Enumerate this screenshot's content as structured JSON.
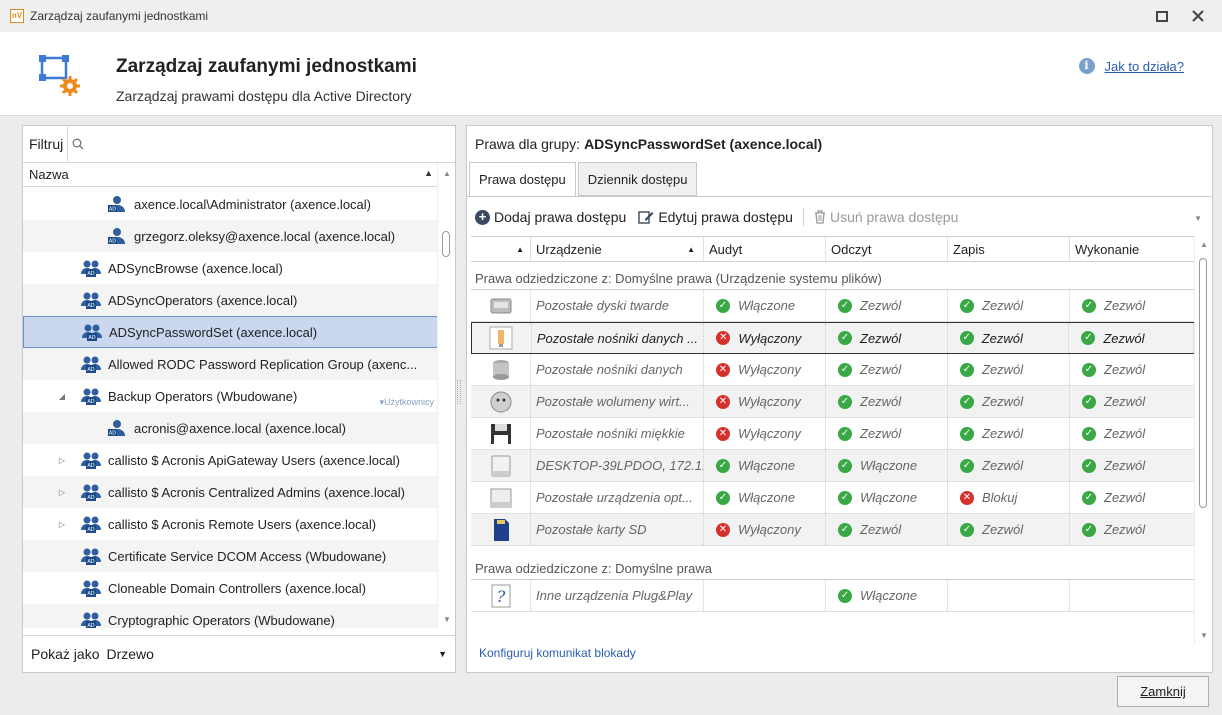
{
  "window": {
    "app_icon_text": "nV",
    "title": "Zarządzaj zaufanymi jednostkami"
  },
  "header": {
    "title": "Zarządzaj zaufanymi jednostkami",
    "subtitle": "Zarządzaj prawami dostępu dla Active Directory",
    "help_link": "Jak to działa?"
  },
  "left": {
    "filter_label": "Filtruj",
    "filter_value": "",
    "column_name": "Nazwa",
    "tree": [
      {
        "label": "axence.local\\Administrator (axence.local)",
        "kind": "user",
        "level": 2,
        "expander": ""
      },
      {
        "label": "grzegorz.oleksy@axence.local (axence.local)",
        "kind": "user",
        "level": 2,
        "expander": ""
      },
      {
        "label": "ADSyncBrowse (axence.local)",
        "kind": "group",
        "level": 1,
        "expander": ""
      },
      {
        "label": "ADSyncOperators (axence.local)",
        "kind": "group",
        "level": 1,
        "expander": ""
      },
      {
        "label": "ADSyncPasswordSet (axence.local)",
        "kind": "group",
        "level": 1,
        "expander": "",
        "selected": true
      },
      {
        "label": "Allowed RODC Password Replication Group (axenc...",
        "kind": "group",
        "level": 1,
        "expander": ""
      },
      {
        "label": "Backup Operators (Wbudowane)",
        "kind": "group",
        "level": 1,
        "expander": "◢",
        "tag": "▾Użytkownicy"
      },
      {
        "label": "acronis@axence.local (axence.local)",
        "kind": "user",
        "level": 2,
        "expander": ""
      },
      {
        "label": "callisto $ Acronis ApiGateway Users (axence.local)",
        "kind": "group",
        "level": 1,
        "expander": "▷"
      },
      {
        "label": "callisto $ Acronis Centralized Admins (axence.local)",
        "kind": "group",
        "level": 1,
        "expander": "▷"
      },
      {
        "label": "callisto $ Acronis Remote Users (axence.local)",
        "kind": "group",
        "level": 1,
        "expander": "▷"
      },
      {
        "label": "Certificate Service DCOM Access (Wbudowane)",
        "kind": "group",
        "level": 1,
        "expander": ""
      },
      {
        "label": "Cloneable Domain Controllers (axence.local)",
        "kind": "group",
        "level": 1,
        "expander": ""
      },
      {
        "label": "Cryptographic Operators (Wbudowane)",
        "kind": "group",
        "level": 1,
        "expander": ""
      }
    ],
    "show_as_label": "Pokaż jako",
    "show_as_value": "Drzewo"
  },
  "right": {
    "rights_for_label": "Prawa dla grupy:",
    "group_name": "ADSyncPasswordSet (axence.local)",
    "tabs": [
      "Prawa dostępu",
      "Dziennik dostępu"
    ],
    "toolbar": {
      "add": "Dodaj prawa dostępu",
      "edit": "Edytuj prawa dostępu",
      "delete": "Usuń prawa dostępu"
    },
    "columns": [
      "Urządzenie",
      "Audyt",
      "Odczyt",
      "Zapis",
      "Wykonanie"
    ],
    "group1_label": "Prawa odziedziczone z: Domyślne prawa (Urządzenie systemu plików)",
    "group1_rows": [
      {
        "icon": "hard-disk",
        "device": "Pozostałe dyski twarde",
        "audit": {
          "t": "Włączone",
          "s": "ok"
        },
        "read": {
          "t": "Zezwól",
          "s": "ok"
        },
        "write": {
          "t": "Zezwól",
          "s": "ok"
        },
        "exec": {
          "t": "Zezwól",
          "s": "ok"
        }
      },
      {
        "icon": "usb-stick",
        "device": "Pozostałe nośniki danych ...",
        "audit": {
          "t": "Wyłączony",
          "s": "bad"
        },
        "read": {
          "t": "Zezwól",
          "s": "ok"
        },
        "write": {
          "t": "Zezwól",
          "s": "ok"
        },
        "exec": {
          "t": "Zezwól",
          "s": "ok"
        },
        "focus": true
      },
      {
        "icon": "storage",
        "device": "Pozostałe nośniki danych",
        "audit": {
          "t": "Wyłączony",
          "s": "bad"
        },
        "read": {
          "t": "Zezwól",
          "s": "ok"
        },
        "write": {
          "t": "Zezwól",
          "s": "ok"
        },
        "exec": {
          "t": "Zezwól",
          "s": "ok"
        }
      },
      {
        "icon": "virtual-volume",
        "device": "Pozostałe wolumeny wirt...",
        "audit": {
          "t": "Wyłączony",
          "s": "bad"
        },
        "read": {
          "t": "Zezwól",
          "s": "ok"
        },
        "write": {
          "t": "Zezwól",
          "s": "ok"
        },
        "exec": {
          "t": "Zezwól",
          "s": "ok"
        }
      },
      {
        "icon": "floppy",
        "device": "Pozostałe nośniki miękkie",
        "audit": {
          "t": "Wyłączony",
          "s": "bad"
        },
        "read": {
          "t": "Zezwól",
          "s": "ok"
        },
        "write": {
          "t": "Zezwól",
          "s": "ok"
        },
        "exec": {
          "t": "Zezwól",
          "s": "ok"
        }
      },
      {
        "icon": "drive",
        "device": "DESKTOP-39LPDOO, 172.1...",
        "audit": {
          "t": "Włączone",
          "s": "ok"
        },
        "read": {
          "t": "Włączone",
          "s": "ok"
        },
        "write": {
          "t": "Zezwól",
          "s": "ok"
        },
        "exec": {
          "t": "Zezwól",
          "s": "ok"
        }
      },
      {
        "icon": "optical-drive",
        "device": "Pozostałe urządzenia opt...",
        "audit": {
          "t": "Włączone",
          "s": "ok"
        },
        "read": {
          "t": "Włączone",
          "s": "ok"
        },
        "write": {
          "t": "Blokuj",
          "s": "bad"
        },
        "exec": {
          "t": "Zezwól",
          "s": "ok"
        }
      },
      {
        "icon": "sd-card",
        "device": "Pozostałe karty SD",
        "audit": {
          "t": "Wyłączony",
          "s": "bad"
        },
        "read": {
          "t": "Zezwól",
          "s": "ok"
        },
        "write": {
          "t": "Zezwól",
          "s": "ok"
        },
        "exec": {
          "t": "Zezwól",
          "s": "ok"
        }
      }
    ],
    "group2_label": "Prawa odziedziczone z: Domyślne prawa",
    "group2_rows": [
      {
        "icon": "plug-and-play",
        "device": "Inne urządzenia Plug&Play",
        "audit": {
          "t": "",
          "s": ""
        },
        "read": {
          "t": "Włączone",
          "s": "ok"
        },
        "write": {
          "t": "",
          "s": ""
        },
        "exec": {
          "t": "",
          "s": ""
        }
      }
    ],
    "config_link": "Konfiguruj komunikat blokady"
  },
  "footer": {
    "close_label": "Zamknij"
  },
  "colors": {
    "accent": "#2a5db0",
    "ok": "#3aa845",
    "bad": "#d7312e",
    "selection": "#cad7ef"
  }
}
